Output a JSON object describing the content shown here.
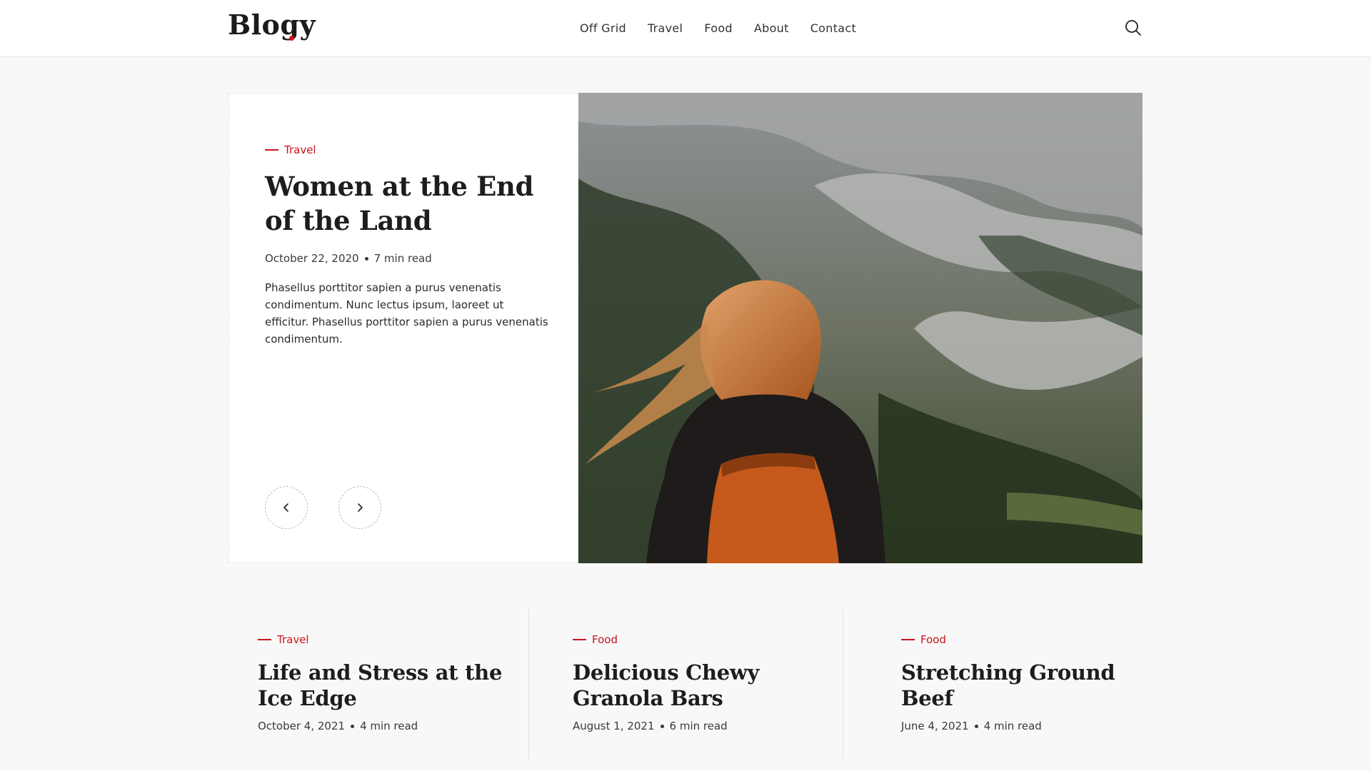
{
  "brand": {
    "name": "Blogy",
    "accent": "#c8141c"
  },
  "nav": {
    "items": [
      {
        "label": "Off Grid"
      },
      {
        "label": "Travel"
      },
      {
        "label": "Food"
      },
      {
        "label": "About"
      },
      {
        "label": "Contact"
      }
    ],
    "search_icon": "search-icon"
  },
  "hero": {
    "category": "Travel",
    "title": "Women at the End of the Land",
    "date": "October 22, 2020",
    "read_time": "7 min read",
    "excerpt": "Phasellus porttitor sapien a purus venenatis condimentum. Nunc lectus ipsum, laoreet ut efficitur. Phasellus porttitor sapien a purus venenatis condimentum.",
    "prev_icon": "chevron-left-icon",
    "next_icon": "chevron-right-icon"
  },
  "posts": [
    {
      "category": "Travel",
      "title": "Life and Stress at the Ice Edge",
      "date": "October 4, 2021",
      "read_time": "4 min read"
    },
    {
      "category": "Food",
      "title": "Delicious Chewy Granola Bars",
      "date": "August 1, 2021",
      "read_time": "6 min read"
    },
    {
      "category": "Food",
      "title": "Stretching Ground Beef",
      "date": "June 4, 2021",
      "read_time": "4 min read"
    }
  ]
}
